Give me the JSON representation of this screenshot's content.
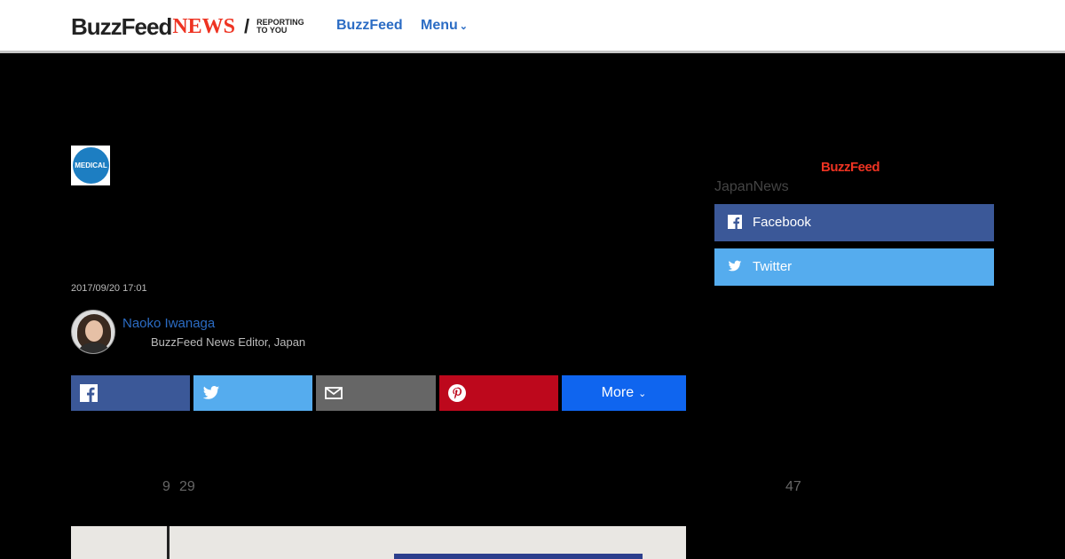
{
  "header": {
    "logo_buzzfeed": "BuzzFeed",
    "logo_news": "NEWS",
    "logo_slash": "/",
    "tagline_line1": "REPORTING",
    "tagline_line2": "TO YOU",
    "nav_buzzfeed": "BuzzFeed",
    "nav_menu": "Menu"
  },
  "article": {
    "badge_label": "MEDICAL",
    "date": "2017/09/20 17:01",
    "author_name": "Naoko Iwanaga",
    "author_title": "BuzzFeed News Editor, Japan",
    "fragment_1": "9",
    "fragment_2": "29",
    "fragment_3": "47"
  },
  "share": {
    "more_label": "More"
  },
  "sidebar": {
    "logo": "BuzzFeed",
    "label": "JapanNews",
    "facebook_label": "Facebook",
    "twitter_label": "Twitter"
  },
  "colors": {
    "facebook": "#3b5898",
    "twitter": "#55acee",
    "email": "#666666",
    "pinterest": "#bd081c",
    "more": "#0f65ef",
    "link": "#2b6cc4",
    "brand_red": "#ee3322"
  },
  "icons": [
    "facebook-icon",
    "twitter-icon",
    "email-icon",
    "pinterest-icon",
    "chevron-down-icon"
  ]
}
